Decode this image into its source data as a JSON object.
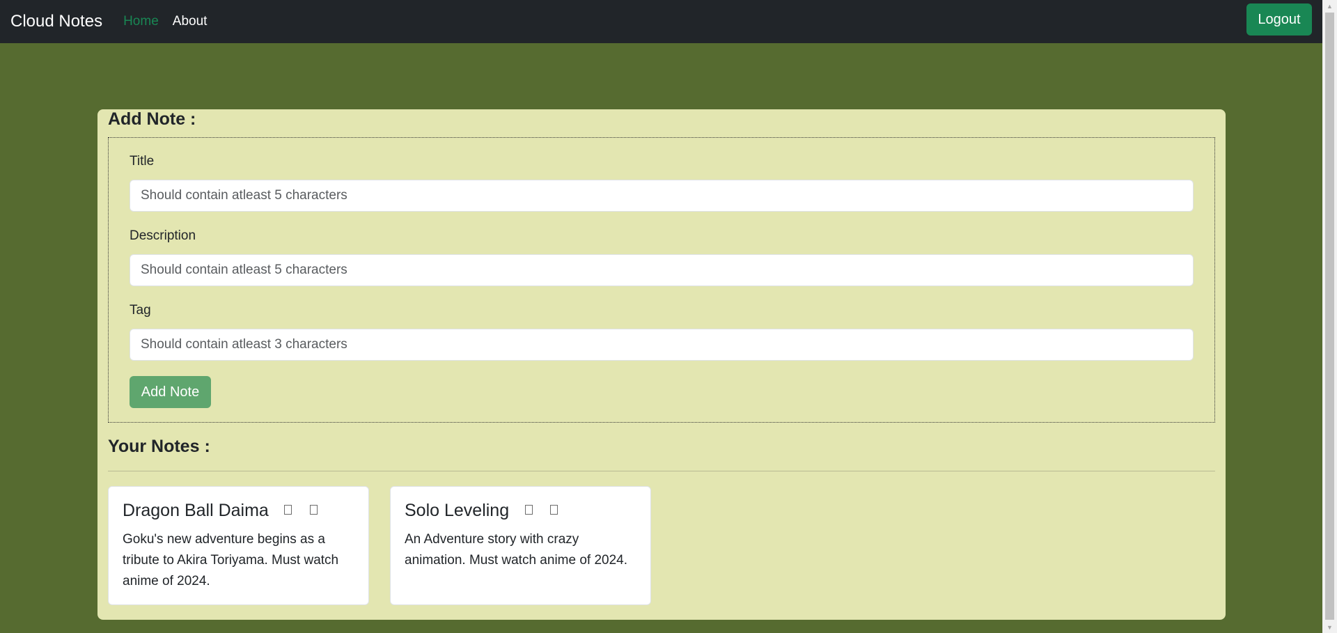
{
  "navbar": {
    "brand": "Cloud Notes",
    "links": [
      {
        "label": "Home"
      },
      {
        "label": "About"
      }
    ],
    "logout_label": "Logout",
    "active_color": "#198754"
  },
  "add_note": {
    "heading": "Add Note :",
    "fields": [
      {
        "label": "Title",
        "placeholder": "Should contain atleast 5 characters"
      },
      {
        "label": "Description",
        "placeholder": "Should contain atleast 5 characters"
      },
      {
        "label": "Tag",
        "placeholder": "Should contain atleast 3 characters"
      }
    ],
    "submit_label": "Add Note"
  },
  "notes_section": {
    "heading": "Your Notes :",
    "notes": [
      {
        "title": "Dragon Ball Daima",
        "description": "Goku's new adventure begins as a tribute to Akira Toriyama. Must watch anime of 2024.",
        "icons": [
          "trash-icon",
          "edit-icon"
        ]
      },
      {
        "title": "Solo Leveling",
        "description": "An Adventure story with crazy animation. Must watch anime of 2024.",
        "icons": [
          "trash-icon",
          "edit-icon"
        ]
      }
    ]
  },
  "colors": {
    "page_background": "#566b30",
    "navbar_background": "#212529",
    "panel_background": "#e3e6b1",
    "logout_button": "#198754",
    "add_button": "#5fa66e"
  }
}
